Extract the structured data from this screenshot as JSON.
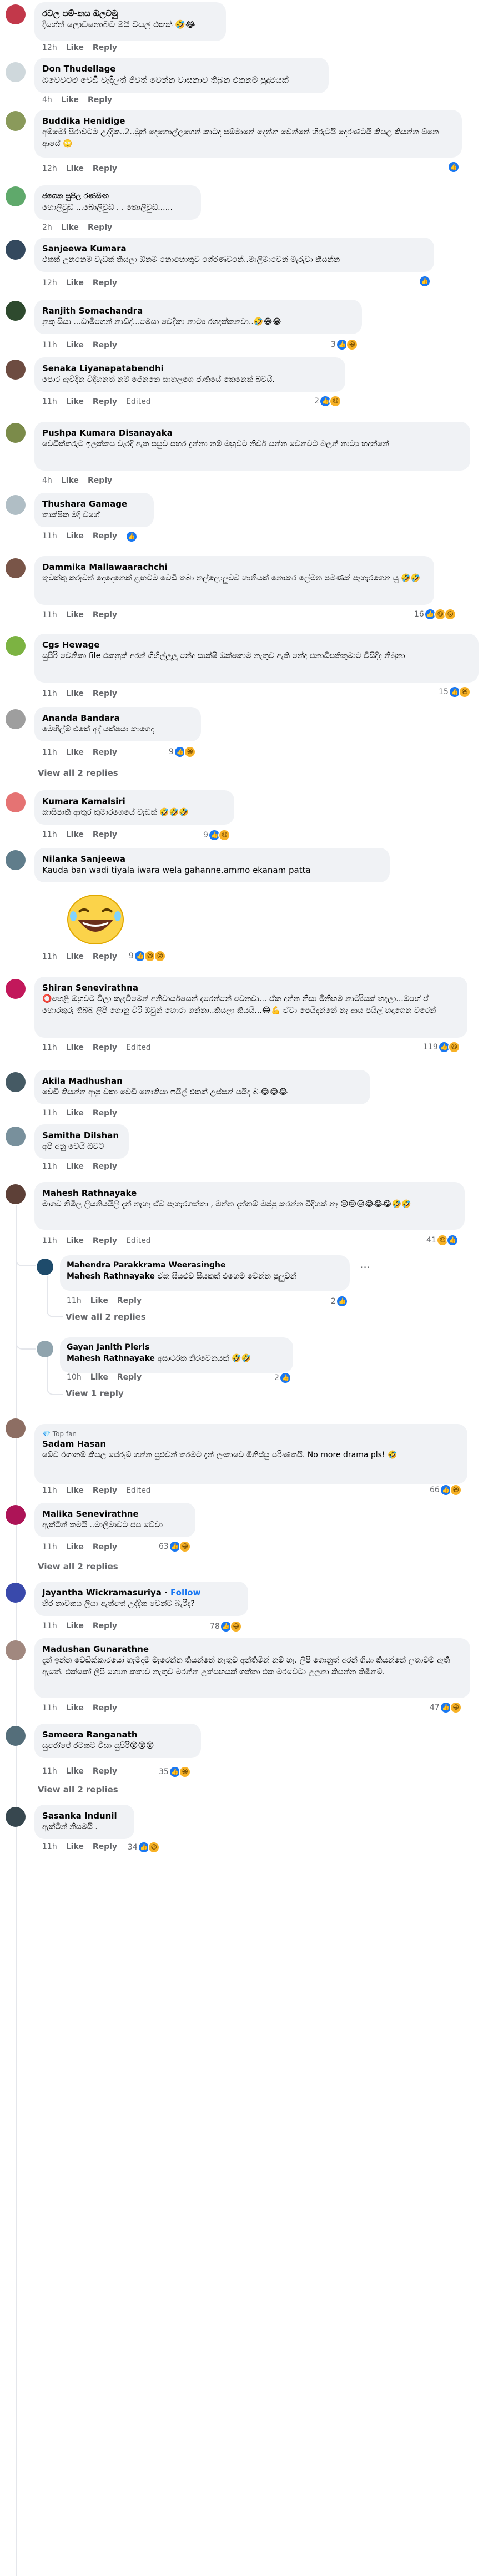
{
  "comments": [
    {
      "name": "රවල පම්-කස ඔලවමු",
      "text": "දිගේන් ලොඩනොබව මයි වයල් එකක් 🤣😂",
      "time": "12h",
      "like": "Like",
      "reply": "Reply"
    },
    {
      "name": "Don Thudellage",
      "text": "ඔවෙවටම වෙඩි වැදිලත් ජීවත් වෙන්න වාසනාව තිබුන එකනම් පුදුමයක්",
      "time": "4h",
      "like": "Like",
      "reply": "Reply"
    },
    {
      "name": "Buddika Henidige",
      "text": "අම්මෝ සිරාවටම උද්දික..2..මුන් දෙනොල්ලගෙන් කාටද සම්මානේ දෙන්න වෙන්නේ හිරුටයි දෙරණටයි කියල කියන්න ඕනෙ ආයේ 🙄",
      "time": "12h",
      "like": "Like",
      "reply": "Reply"
    },
    {
      "name": "ජගෙක සුපිල රණසිංහ",
      "text": "හොලිවුඩ් ...බොලිවුඩ් . . කොලිවුඩ්......",
      "time": "2h",
      "like": "Like",
      "reply": "Reply"
    },
    {
      "name": "Sanjeewa Kumara",
      "text": "එකක් උන්නෙම වැඩක් කියලා ඕනම නොහොතුව ගේරණවනේ..මාලිමාවෙන් මැරුවා කියන්න",
      "time": "12h",
      "like": "Like",
      "reply": "Reply"
    },
    {
      "name": "Ranjith Somachandra",
      "text": "නුකු සියා ...ඩාමිගෙන් නාඩ්ද්...මෙයා වෙදිකා නාට්‍ය රගදක්කනවා..🤣😂😂",
      "time": "11h",
      "like": "Like",
      "reply": "Reply",
      "count": "3"
    },
    {
      "name": "Senaka Liyanapatabendhi",
      "text": "පොර ඇවිදින විදිහනත් නම් ජේන්නෙ සාහලගෙ ජාතියේ කෙනෙක් බවයි.",
      "time": "11h",
      "like": "Like",
      "reply": "Reply",
      "edited": "Edited",
      "count": "2"
    },
    {
      "name": "Pushpa Kumara Disanayaka",
      "text": "වෙඩික්කරුට ඉලක්කය වැරදි ඇත පසුව පහර දුන්නා නම් ඔහුවට නිර්ව යන්න වෙනවට බලන් නාට්‍ය හදන්නේ",
      "time": "4h",
      "like": "Like",
      "reply": "Reply"
    },
    {
      "name": "Thushara Gamage",
      "text": "තාක්ෂික මදි වගේ",
      "time": "11h",
      "like": "Like",
      "reply": "Reply"
    },
    {
      "name": "Dammika Mallawaarachchi",
      "text": "තුවක්කු කරුවන් දෙදෙනෙක් ළඟටම වෙඩි තබා නල්ලොලුවව හානියක් නොකර ලේමන පමණක් පැහැරගෙන යූ 🤣🤣",
      "time": "11h",
      "like": "Like",
      "reply": "Reply",
      "count": "16"
    },
    {
      "name": "Cgs Hewage",
      "text": "සුපිරි වෙනිකා file එකනුත් අරන් ගිහිල්ලුලු නේද සාක්ෂි ඔක්කොම නැතුව ඇති නේද ජනාධිපතිතුමාට විසිදිද නිබුනා",
      "time": "11h",
      "like": "Like",
      "reply": "Reply",
      "count": "15"
    },
    {
      "name": "Ananda Bandara",
      "text": "මෙහිල්ම් එකේ අද් යක්ෂයා කාගෙද",
      "time": "11h",
      "like": "Like",
      "reply": "Reply",
      "count": "9",
      "view": "View all 2 replies"
    },
    {
      "name": "Kumara Kamalsiri",
      "text": "කාසිපාකි ආතුර කුමාරගෙයේ වැඩක් 🤣🤣🤣",
      "time": "11h",
      "like": "Like",
      "reply": "Reply",
      "count": "9"
    },
    {
      "name": "Nilanka Sanjeewa",
      "text": "Kauda ban wadi tiyala iwara wela gahanne.ammo ekanam patta",
      "time": "11h",
      "like": "Like",
      "reply": "Reply",
      "count": "9"
    },
    {
      "name": "Shiran Senevirathna",
      "text": "⭕හෙළි ඔහුවට විලා කැදවීමෙන් අනිවාර්යයෙන් දැරෙන්නේ වෙනවා... ඒක දන්න නිසා මිනිහම නාට්‍යියක් හදලා...ඔහේ ඒ හොරකුරු තිබ්බ ලිපි ගොනු විරි ඔවුන් හොරා ගන්නා..කියලා කියයි...😂💪 ඒවා පෙයිදන්නේ නැ ආය පයිල් හදාගෙන වරෙන්",
      "time": "11h",
      "like": "Like",
      "reply": "Reply",
      "edited": "Edited",
      "count": "119"
    },
    {
      "name": "Akila Madhushan",
      "text": "වෙඩි තියන්න ආපු වකා වෙඩි නොතියා ෆයිල් එකක් උස්සන් යයිද බං😂😂😂",
      "time": "11h",
      "like": "Like",
      "reply": "Reply"
    },
    {
      "name": "Samitha Dilshan",
      "text": "අපි අනු වෙයි ඔවට",
      "time": "11h",
      "like": "Like",
      "reply": "Reply"
    },
    {
      "name": "Mahesh Rathnayake",
      "text": "මාගව නිමිල ලියනියයිලි දැන් නැහැ ඒව පැහැරගත්තා , ඔන්න දැන්නම් ඔප්පු කරන්න විදිහක් නෑ 😔😔😔😂😂😂🤣🤣",
      "time": "11h",
      "like": "Like",
      "reply": "Reply",
      "edited": "Edited",
      "count": "41"
    },
    {
      "name": "Mahendra Parakkrama Weerasinghe",
      "tag": "Mahesh Rathnayake",
      "text": "ඒක සියළුව සියකක් එහෙම වෙන්න පුලුවන්",
      "time": "11h",
      "like": "Like",
      "reply": "Reply",
      "count": "2",
      "view": "View all 2 replies"
    },
    {
      "name": "Gayan Janith Pieris",
      "tag": "Mahesh Rathnayake",
      "text": "අසාර්ථක නිරවෙනයක් 🤣🤣",
      "time": "10h",
      "like": "Like",
      "reply": "Reply",
      "count": "2",
      "view": "View 1 reply"
    },
    {
      "badge": "Top fan",
      "name": "Sadam Hasan",
      "text": "මේව ඊගානම් කියල පේරුම් ගන්න පුළුවන් තරමට දැන් ලංකාවෙ මිනිස්සු පරිණතයි. No more drama pls! 🤣",
      "time": "11h",
      "like": "Like",
      "reply": "Reply",
      "edited": "Edited",
      "count": "66"
    },
    {
      "name": "Malika Senevirathne",
      "text": "ඇක්ටින් තමයි ..මාලිමාවට ජය වේවා",
      "time": "11h",
      "like": "Like",
      "reply": "Reply",
      "count": "63",
      "view": "View all 2 replies"
    },
    {
      "name": "Jayantha Wickramasuriya",
      "follow": "Follow",
      "text": "හිර නාවකය ලියා ඇත්තේ උද්දික වෙන්ට බැරිද?",
      "time": "11h",
      "like": "Like",
      "reply": "Reply",
      "count": "78"
    },
    {
      "name": "Madushan Gunarathne",
      "text": "දැන් ඉන්න වෙඩික්කාරයෝ හැමදාම මැරෙන්න තියන්නේ නැතුව අන්තිමින් නම් හැ. ලිපි ගොනුත් අරන් ගියා කියන්නේ ලතාවම ඇති ඇතේ. එක්කෝ ලිපි ගොනු කතාව නැතුව මරන්න උත්සහයක් ගත්තා එක මරවෙටා උලනා කියන්න තිමිනම්.",
      "time": "11h",
      "like": "Like",
      "reply": "Reply",
      "count": "47"
    },
    {
      "name": "Sameera Ranganath",
      "text": "යුරෝපේ රටකට වීසා සුපිරී😲😲😲",
      "time": "11h",
      "like": "Like",
      "reply": "Reply",
      "count": "35",
      "view": "View all 2 replies"
    },
    {
      "name": "Sasanka Indunil",
      "text": "ඇක්ටින් නියමයි .",
      "time": "11h",
      "like": "Like",
      "reply": "Reply",
      "count": "34"
    }
  ],
  "sticker": "laughing-face-sticker"
}
